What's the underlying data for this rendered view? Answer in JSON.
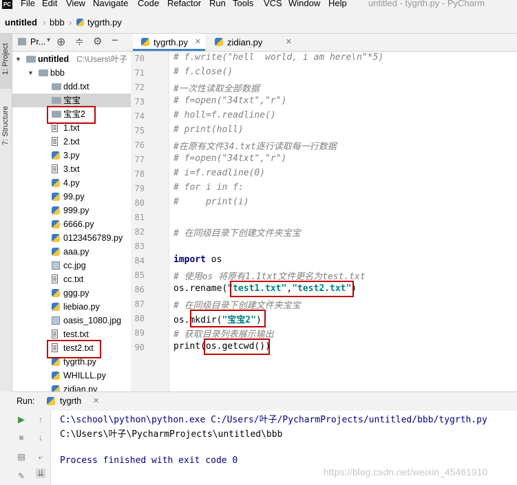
{
  "app": {
    "logo_text": "PC",
    "window_title": "untitled - tygrth.py - PyCharm"
  },
  "menu": [
    "File",
    "Edit",
    "View",
    "Navigate",
    "Code",
    "Refactor",
    "Run",
    "Tools",
    "VCS",
    "Window",
    "Help"
  ],
  "breadcrumb": [
    "untitled",
    "bbb",
    "tygrth.py"
  ],
  "left_strip": {
    "project_tab": "1: Project",
    "structure_tab": "7: Structure"
  },
  "project_panel": {
    "title": "Pr..."
  },
  "tree": [
    {
      "label": "untitled",
      "suffix": "C:\\Users\\叶子",
      "type": "folder",
      "level": 0,
      "expanded": true,
      "bold": true
    },
    {
      "label": "bbb",
      "type": "folder",
      "level": 1,
      "expanded": true
    },
    {
      "label": "ddd.txt",
      "type": "folder",
      "level": 2
    },
    {
      "label": "宝宝",
      "type": "folder",
      "level": 2,
      "selected": true
    },
    {
      "label": "宝宝2",
      "type": "folder",
      "level": 2,
      "highlight": true
    },
    {
      "label": "1.txt",
      "type": "txt",
      "level": 2
    },
    {
      "label": "2.txt",
      "type": "txt",
      "level": 2
    },
    {
      "label": "3.py",
      "type": "py",
      "level": 2
    },
    {
      "label": "3.txt",
      "type": "txt",
      "level": 2
    },
    {
      "label": "4.py",
      "type": "py",
      "level": 2
    },
    {
      "label": "99.py",
      "type": "py",
      "level": 2
    },
    {
      "label": "999.py",
      "type": "py",
      "level": 2
    },
    {
      "label": "6666.py",
      "type": "py",
      "level": 2
    },
    {
      "label": "0123456789.py",
      "type": "py",
      "level": 2
    },
    {
      "label": "aaa.py",
      "type": "py",
      "level": 2
    },
    {
      "label": "cc.jpg",
      "type": "img",
      "level": 2
    },
    {
      "label": "cc.txt",
      "type": "txt",
      "level": 2
    },
    {
      "label": "ggg.py",
      "type": "py",
      "level": 2
    },
    {
      "label": "liebiao.py",
      "type": "py",
      "level": 2
    },
    {
      "label": "oasis_1080.jpg",
      "type": "img",
      "level": 2
    },
    {
      "label": "test.txt",
      "type": "txt",
      "level": 2
    },
    {
      "label": "test2.txt",
      "type": "txt",
      "level": 2,
      "highlight": true
    },
    {
      "label": "tygrth.py",
      "type": "py",
      "level": 2
    },
    {
      "label": "WHILLL.py",
      "type": "py",
      "level": 2
    },
    {
      "label": "zidian.py",
      "type": "py",
      "level": 2
    }
  ],
  "editor_tabs": [
    {
      "label": "tygrth.py",
      "active": true
    },
    {
      "label": "zidian.py",
      "active": false
    }
  ],
  "code_lines": [
    {
      "n": "70",
      "t": "# f.write(\"hell  world, i am here\\n\"*5)",
      "c": "cmt"
    },
    {
      "n": "71",
      "t": "# f.close()",
      "c": "cmt"
    },
    {
      "n": "72",
      "t": "#一次性读取全部数据",
      "c": "cmt"
    },
    {
      "n": "73",
      "t": "# f=open(\"34txt\",\"r\")",
      "c": "cmt"
    },
    {
      "n": "74",
      "t": "# holl=f.readline()",
      "c": "cmt"
    },
    {
      "n": "75",
      "t": "# print(holl)",
      "c": "cmt"
    },
    {
      "n": "76",
      "t": "#在原有文件34.txt逐行读取每一行数据",
      "c": "cmt"
    },
    {
      "n": "77",
      "t": "# f=open(\"34txt\",\"r\")",
      "c": "cmt"
    },
    {
      "n": "78",
      "t": "# i=f.readline(0)",
      "c": "cmt"
    },
    {
      "n": "79",
      "t": "# for i in f:",
      "c": "cmt"
    },
    {
      "n": "80",
      "t": "#     print(i)",
      "c": "cmt"
    },
    {
      "n": "81",
      "t": "",
      "c": ""
    },
    {
      "n": "82",
      "t": "# 在同级目录下创建文件夹宝宝",
      "c": "cmt"
    },
    {
      "n": "83",
      "t": "",
      "c": ""
    },
    {
      "n": "84",
      "t": "import os",
      "c": "import"
    },
    {
      "n": "85",
      "t": "# 使用os 将原有1.1txt文件更名为test.txt",
      "c": "cmt"
    },
    {
      "n": "86",
      "t": "os.rename(\"test1.txt\",\"test2.txt\")",
      "c": "rename"
    },
    {
      "n": "87",
      "t": "# 在同级目录下创建文件夹宝宝",
      "c": "cmt"
    },
    {
      "n": "88",
      "t": "os.mkdir(\"宝宝2\")",
      "c": "mkdir"
    },
    {
      "n": "89",
      "t": "# 获取目录列表展示输出",
      "c": "cmt"
    },
    {
      "n": "90",
      "t": "print(os.getcwd())",
      "c": "print"
    }
  ],
  "code_parts": {
    "import_kw": "import",
    "import_rest": " os",
    "rename_pre": "os.rename(",
    "rename_s1": "\"test1.txt\"",
    "rename_comma": ",",
    "rename_s2": "\"test2.txt\"",
    "rename_post": ")",
    "mkdir_pre": "os.",
    "mkdir_fn": "mkdir(",
    "mkdir_s": "\"宝宝2\"",
    "mkdir_post": ")",
    "print_pre": "print(",
    "print_arg": "os.getcwd()",
    "print_post": ")"
  },
  "run": {
    "label": "Run:",
    "config": "tygrth",
    "output": [
      "C:\\school\\python\\python.exe C:/Users/叶子/PycharmProjects/untitled/bbb/tygrth.py",
      "C:\\Users\\叶子\\PycharmProjects\\untitled\\bbb",
      "",
      "Process finished with exit code 0"
    ]
  },
  "watermark": "https://blog.csdn.net/weixin_45461910",
  "colors": {
    "highlight_box": "#c00000",
    "accent": "#4083c9",
    "comment": "#808080",
    "keyword": "#000080",
    "string": "#008080"
  }
}
